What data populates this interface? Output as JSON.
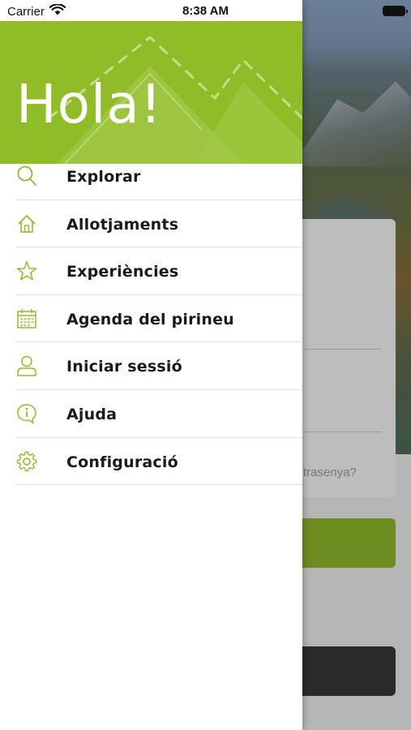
{
  "status_bar": {
    "carrier": "Carrier",
    "time": "8:38 AM"
  },
  "drawer": {
    "greeting": "Hola!",
    "accent_color": "#90bd27",
    "items": [
      {
        "label": "Explorar",
        "icon": "search-icon"
      },
      {
        "label": "Allotjaments",
        "icon": "home-icon"
      },
      {
        "label": "Experiències",
        "icon": "star-icon"
      },
      {
        "label": "Agenda del pirineu",
        "icon": "calendar-icon"
      },
      {
        "label": "Iniciar sessió",
        "icon": "user-icon"
      },
      {
        "label": "Ajuda",
        "icon": "info-icon"
      },
      {
        "label": "Configuració",
        "icon": "gear-icon"
      }
    ]
  },
  "background_screen": {
    "forgot_password_partial": "trasenya?"
  }
}
